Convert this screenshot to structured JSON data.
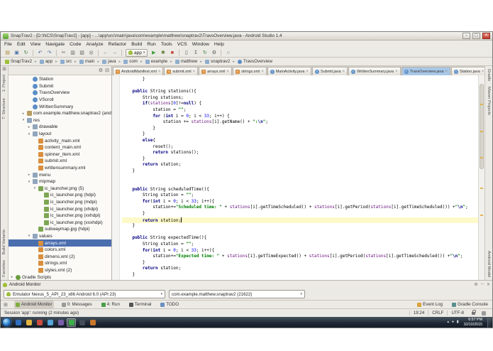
{
  "glyphs": {
    "chevron_down": "▾",
    "crumb_sep": "▸",
    "tab_close": "×",
    "tray_up": "▴",
    "tray_net": "●",
    "tray_vol": "▮",
    "grid": "⊞"
  },
  "window": {
    "title": "SnapTrav2 - [D:\\NCS\\SnapTrav2] - [app] - ...\\app\\src\\main\\java\\com\\example\\matthew\\snaptrav2\\TravsOverview.java - Android Studio 1.4",
    "controls": {
      "min": "–",
      "max": "▢",
      "close": "✕"
    }
  },
  "menubar": [
    "File",
    "Edit",
    "View",
    "Navigate",
    "Code",
    "Analyze",
    "Refactor",
    "Build",
    "Run",
    "Tools",
    "VCS",
    "Window",
    "Help"
  ],
  "toolbar": {
    "run_config": "app",
    "left": [
      {
        "name": "open-file-icon",
        "glyph": "▤",
        "color": "#a3862f"
      },
      {
        "name": "save-all-icon",
        "glyph": "▣",
        "color": "#4a6fa5"
      },
      {
        "name": "sync-icon",
        "glyph": "↻",
        "color": "#3f7d3f"
      },
      {
        "sep": true
      },
      {
        "name": "undo-icon",
        "glyph": "↶",
        "color": "#44609a"
      },
      {
        "name": "redo-icon",
        "glyph": "↷",
        "color": "#44609a"
      },
      {
        "sep": true
      },
      {
        "name": "cut-icon",
        "glyph": "✂",
        "color": "#666666"
      },
      {
        "name": "copy-icon",
        "glyph": "▥",
        "color": "#666666"
      },
      {
        "name": "paste-icon",
        "glyph": "▧",
        "color": "#666666"
      },
      {
        "name": "find-icon",
        "glyph": "◎",
        "color": "#555555"
      },
      {
        "sep": true
      },
      {
        "name": "back-icon",
        "glyph": "←",
        "color": "#666666"
      },
      {
        "name": "forward-icon",
        "glyph": "→",
        "color": "#666666"
      },
      {
        "sep": true
      }
    ],
    "right": [
      {
        "name": "run-button",
        "glyph": "▶",
        "color": "#3f9e3f"
      },
      {
        "name": "debug-button",
        "glyph": "✱",
        "color": "#5a7d2f"
      },
      {
        "name": "stop-button",
        "glyph": "■",
        "color": "#c0392b"
      },
      {
        "sep": true
      },
      {
        "name": "avd-manager-icon",
        "glyph": "▯",
        "color": "#555555"
      },
      {
        "name": "sdk-manager-icon",
        "glyph": "↧",
        "color": "#555555"
      },
      {
        "name": "gradle-sync-icon",
        "glyph": "↻",
        "color": "#3f7d3f"
      },
      {
        "name": "settings-gear-icon",
        "glyph": "⚙",
        "color": "#555555"
      },
      {
        "sep": true
      },
      {
        "name": "search-icon",
        "glyph": "○",
        "color": "#555555"
      }
    ]
  },
  "breadcrumbs": [
    "SnapTrav2",
    "app",
    "src",
    "main",
    "java",
    "com",
    "example",
    "matthew",
    "snaptrav2",
    "TravsOverview"
  ],
  "strips": {
    "left_top": [
      "1: Project",
      "7: Structure"
    ],
    "left_bottom": [
      "Build Variants",
      "Favorites"
    ],
    "right_top": [
      "Gradle",
      "Maven Projects"
    ],
    "right_bottom": [
      "Android Model"
    ]
  },
  "project": {
    "header_icons": [
      {
        "name": "settings-gear-icon",
        "glyph": "⚙"
      },
      {
        "name": "collapse-all-icon",
        "glyph": "⊟"
      }
    ],
    "tree": [
      {
        "i": 3,
        "t": "class",
        "l": "Station"
      },
      {
        "i": 3,
        "t": "class",
        "l": "Submit"
      },
      {
        "i": 3,
        "t": "class",
        "l": "TravsOverview"
      },
      {
        "i": 3,
        "t": "class",
        "l": "VScroll"
      },
      {
        "i": 3,
        "t": "class",
        "l": "WrittenSummary"
      },
      {
        "i": 2,
        "t": "package",
        "l": "com.example.matthew.snaptrav2 (andr",
        "a": ">"
      },
      {
        "i": 2,
        "t": "folder",
        "l": "res",
        "a": "v"
      },
      {
        "i": 3,
        "t": "folder",
        "l": "drawable",
        "a": ">"
      },
      {
        "i": 3,
        "t": "folder",
        "l": "layout",
        "a": "v"
      },
      {
        "i": 4,
        "t": "xml",
        "l": "activity_main.xml"
      },
      {
        "i": 4,
        "t": "xml",
        "l": "content_main.xml"
      },
      {
        "i": 4,
        "t": "xml",
        "l": "spinner_item.xml"
      },
      {
        "i": 4,
        "t": "xml",
        "l": "submit.xml"
      },
      {
        "i": 4,
        "t": "xml",
        "l": "writtensummary.xml"
      },
      {
        "i": 3,
        "t": "folder",
        "l": "menu",
        "a": ">"
      },
      {
        "i": 3,
        "t": "folder",
        "l": "mipmap",
        "a": "v"
      },
      {
        "i": 4,
        "t": "image",
        "l": "ic_launcher.png (5)",
        "a": "v"
      },
      {
        "i": 5,
        "t": "image",
        "l": "ic_launcher.png (hdpi)"
      },
      {
        "i": 5,
        "t": "image",
        "l": "ic_launcher.png (mdpi)"
      },
      {
        "i": 5,
        "t": "image",
        "l": "ic_launcher.png (xhdpi)"
      },
      {
        "i": 5,
        "t": "image",
        "l": "ic_launcher.png (xxhdpi)"
      },
      {
        "i": 5,
        "t": "image",
        "l": "ic_launcher.png (xxxhdpi)"
      },
      {
        "i": 4,
        "t": "image",
        "l": "subwaymap.jpg (hdpi)"
      },
      {
        "i": 3,
        "t": "folder",
        "l": "values",
        "a": "v"
      },
      {
        "i": 4,
        "t": "xml",
        "l": "arrays.xml",
        "sel": true
      },
      {
        "i": 4,
        "t": "xml",
        "l": "colors.xml"
      },
      {
        "i": 4,
        "t": "xml",
        "l": "dimens.xml (2)"
      },
      {
        "i": 4,
        "t": "xml",
        "l": "strings.xml"
      },
      {
        "i": 4,
        "t": "xml",
        "l": "styles.xml (2)"
      },
      {
        "i": 0,
        "t": "gradle",
        "l": "Gradle Scripts",
        "a": ">"
      }
    ]
  },
  "tabs": [
    {
      "label": "AndroidManifest.xml",
      "kind": "xml"
    },
    {
      "label": "submit.xml",
      "kind": "xml"
    },
    {
      "label": "arrays.xml",
      "kind": "xml"
    },
    {
      "label": "strings.xml",
      "kind": "xml"
    },
    {
      "label": "MainActivity.java",
      "kind": "java"
    },
    {
      "label": "Submit.java",
      "kind": "java"
    },
    {
      "label": "WrittenSummary.java",
      "kind": "java"
    },
    {
      "label": "TravsOverview.java",
      "kind": "java",
      "active": true
    },
    {
      "label": "Station.java",
      "kind": "java"
    }
  ],
  "editor": {
    "caret_line": 23,
    "right_marks": [
      14,
      27,
      40,
      55,
      68
    ],
    "lines": [
      [
        [
          "pl",
          "        }"
        ]
      ],
      [],
      [
        [
          "pl",
          "    "
        ],
        [
          "kw",
          "public"
        ],
        [
          "pl",
          " String stations(){"
        ]
      ],
      [
        [
          "pl",
          "        String stations;"
        ]
      ],
      [
        [
          "pl",
          "        "
        ],
        [
          "kw",
          "if"
        ],
        [
          "pl",
          "("
        ],
        [
          "fld",
          "stations"
        ],
        [
          "pl",
          "["
        ],
        [
          "num",
          "0"
        ],
        [
          "pl",
          "]!="
        ],
        [
          "kw",
          "null"
        ],
        [
          "pl",
          ") {"
        ]
      ],
      [
        [
          "pl",
          "            station = "
        ],
        [
          "str",
          "\"\""
        ],
        [
          "pl",
          ";"
        ]
      ],
      [
        [
          "pl",
          "            "
        ],
        [
          "kw",
          "for"
        ],
        [
          "pl",
          " ("
        ],
        [
          "kw",
          "int"
        ],
        [
          "pl",
          " i = "
        ],
        [
          "num",
          "0"
        ],
        [
          "pl",
          "; i < "
        ],
        [
          "num",
          "33"
        ],
        [
          "pl",
          "; i++) {"
        ]
      ],
      [
        [
          "pl",
          "                station += "
        ],
        [
          "fld",
          "stations"
        ],
        [
          "pl",
          "[i].getName() + "
        ],
        [
          "str",
          "\":"
        ],
        [
          "esc",
          "\\n"
        ],
        [
          "str",
          "\""
        ],
        [
          "pl",
          ";"
        ]
      ],
      [
        [
          "pl",
          "            }"
        ]
      ],
      [
        [
          "pl",
          "        }"
        ]
      ],
      [
        [
          "pl",
          "        "
        ],
        [
          "kw",
          "else"
        ],
        [
          "pl",
          "{"
        ]
      ],
      [
        [
          "pl",
          "            reset();"
        ]
      ],
      [
        [
          "pl",
          "            "
        ],
        [
          "kw",
          "return"
        ],
        [
          "pl",
          " stations();"
        ]
      ],
      [
        [
          "pl",
          "        }"
        ]
      ],
      [
        [
          "pl",
          "        "
        ],
        [
          "kw",
          "return"
        ],
        [
          "pl",
          " station;"
        ]
      ],
      [
        [
          "pl",
          "    }"
        ]
      ],
      [],
      [],
      [
        [
          "pl",
          "    "
        ],
        [
          "kw",
          "public"
        ],
        [
          "pl",
          " String scheduledTime(){"
        ]
      ],
      [
        [
          "pl",
          "        String station = "
        ],
        [
          "str",
          "\"\""
        ],
        [
          "pl",
          ";"
        ]
      ],
      [
        [
          "pl",
          "        "
        ],
        [
          "kw",
          "for"
        ],
        [
          "pl",
          "("
        ],
        [
          "kw",
          "int"
        ],
        [
          "pl",
          " i = "
        ],
        [
          "num",
          "0"
        ],
        [
          "pl",
          "; i < "
        ],
        [
          "num",
          "33"
        ],
        [
          "pl",
          "; i++){"
        ]
      ],
      [
        [
          "pl",
          "            station+="
        ],
        [
          "str",
          "\"Scheduled time: \""
        ],
        [
          "pl",
          " + "
        ],
        [
          "fld",
          "stations"
        ],
        [
          "pl",
          "[i].getTimeScheduled() + "
        ],
        [
          "fld",
          "stations"
        ],
        [
          "pl",
          "[i].getPeriod("
        ],
        [
          "fld",
          "stations"
        ],
        [
          "pl",
          "[i].getTimeScheduled()) +"
        ],
        [
          "str",
          "\""
        ],
        [
          "esc",
          "\\n"
        ],
        [
          "str",
          "\""
        ],
        [
          "pl",
          ";"
        ]
      ],
      [
        [
          "pl",
          "        }"
        ]
      ],
      [
        [
          "pl",
          "        "
        ],
        [
          "kw",
          "return"
        ],
        [
          "pl",
          " station;"
        ]
      ],
      [
        [
          "pl",
          "    }"
        ]
      ],
      [],
      [
        [
          "pl",
          "    "
        ],
        [
          "kw",
          "public"
        ],
        [
          "pl",
          " String expectedTime(){"
        ]
      ],
      [
        [
          "pl",
          "        String station = "
        ],
        [
          "str",
          "\"\""
        ],
        [
          "pl",
          ";"
        ]
      ],
      [
        [
          "pl",
          "        "
        ],
        [
          "kw",
          "for"
        ],
        [
          "pl",
          "("
        ],
        [
          "kw",
          "int"
        ],
        [
          "pl",
          " i = "
        ],
        [
          "num",
          "0"
        ],
        [
          "pl",
          "; i < "
        ],
        [
          "num",
          "33"
        ],
        [
          "pl",
          "; i++){"
        ]
      ],
      [
        [
          "pl",
          "            station+="
        ],
        [
          "str",
          "\"Expected time: \""
        ],
        [
          "pl",
          " + "
        ],
        [
          "fld",
          "stations"
        ],
        [
          "pl",
          "[i].getTimeExpected() + "
        ],
        [
          "fld",
          "stations"
        ],
        [
          "pl",
          "[i].getPeriod("
        ],
        [
          "fld",
          "stations"
        ],
        [
          "pl",
          "[i].getTimeScheduled()) +"
        ],
        [
          "str",
          "\""
        ],
        [
          "esc",
          "\\n"
        ],
        [
          "str",
          "\""
        ],
        [
          "pl",
          ";"
        ]
      ],
      [
        [
          "pl",
          "        }"
        ]
      ],
      [
        [
          "pl",
          "        "
        ],
        [
          "kw",
          "return"
        ],
        [
          "pl",
          " station;"
        ]
      ],
      [
        [
          "pl",
          "    }"
        ]
      ]
    ]
  },
  "monitor": {
    "tab": "Android Monitor",
    "device": "Emulator Nexus_5_API_23_x86 Android 6.0 (API 23)",
    "process": "com.example.matthew.snaptrav2 (21622)",
    "header_icons": [
      {
        "name": "settings-gear-icon",
        "glyph": "⚙"
      },
      {
        "name": "minimize-panel-icon",
        "glyph": "─"
      },
      {
        "name": "close-panel-icon",
        "glyph": "✕"
      }
    ]
  },
  "toolbuttons": {
    "left": [
      {
        "label": "Android Monitor",
        "icon": "android-icon",
        "color": "#7fae3f",
        "active": true
      },
      {
        "label": "0: Messages",
        "icon": "messages-icon",
        "color": "#9a9a9a"
      },
      {
        "label": "4: Run",
        "icon": "run-icon",
        "color": "#4a9e4a"
      },
      {
        "label": "Terminal",
        "icon": "terminal-icon",
        "color": "#555555"
      },
      {
        "label": "TODO",
        "icon": "todo-icon",
        "color": "#6a8fc0"
      }
    ],
    "right": [
      {
        "label": "Event Log",
        "icon": "event-log-icon",
        "color": "#d8a23c"
      },
      {
        "label": "Gradle Console",
        "icon": "gradle-icon",
        "color": "#5a8f8f"
      }
    ]
  },
  "status": {
    "message": "Session 'app': running (2 minutes ago)",
    "position": "19:24",
    "line_ending": "CRLF",
    "encoding": "UTF-8"
  },
  "taskbar": {
    "time": "6:57 PM",
    "date": "10/10/2015",
    "active_index": 5,
    "apps": [
      {
        "name": "taskbar-app-1",
        "color": "#2f6fbe"
      },
      {
        "name": "taskbar-app-2",
        "color": "#e3b341"
      },
      {
        "name": "taskbar-app-3",
        "color": "#cc4b3c"
      },
      {
        "name": "taskbar-app-4",
        "color": "#57a4d9"
      },
      {
        "name": "taskbar-app-5",
        "color": "#7a5fa8"
      },
      {
        "name": "taskbar-app-6",
        "color": "#3dae4a"
      },
      {
        "name": "taskbar-app-7",
        "color": "#444c58"
      },
      {
        "name": "taskbar-app-8",
        "color": "#c8762c"
      }
    ]
  }
}
